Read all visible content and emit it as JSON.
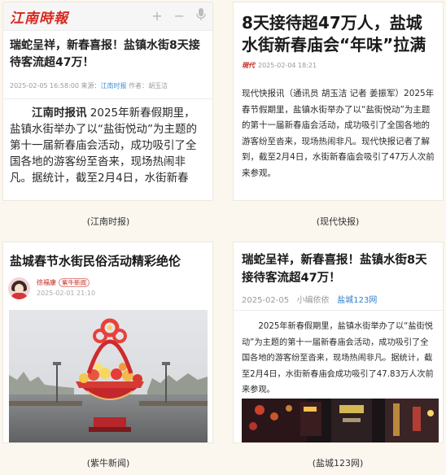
{
  "cards": [
    {
      "logo": "江南時報",
      "title": "瑞蛇呈祥，新春喜报！盐镇水街8天接待客流超47万！",
      "date": "2025-02-05 16:58:00",
      "source_label": "来源：",
      "source": "江南时报",
      "author_label": "作者：",
      "author": "胡玉洁",
      "body_lead": "江南时报讯",
      "body": " 2025年新春假期里，盐镇水街举办了以“盐街悦动”为主题的第十一届新春庙会活动，成功吸引了全国各地的游客纷至沓来，现场热闹非凡。据统计，截至2月4日，水街新春",
      "caption": "(江南时报)"
    },
    {
      "title": "8天接待超47万人，盐城水街新春庙会“年味”拉满",
      "brand": "現代",
      "date": "2025-02-04 18:21",
      "body": "现代快报讯（通讯员 胡玉洁 记者 姜振军）2025年春节假期里，盐镇水街举办了以“盐街悦动”为主题的第十一届新春庙会活动，成功吸引了全国各地的游客纷至沓来，现场热闹非凡。现代快报记者了解到，截至2月4日，水街新春庙会吸引了47万人次前来参观。",
      "caption": "(现代快报)"
    },
    {
      "title": "盐城春节水街民俗活动精彩绝伦",
      "author": "徐福康",
      "badge": "紫牛新闻",
      "date": "2025-02-01 21:10",
      "caption": "(紫牛新闻)"
    },
    {
      "title": "瑞蛇呈祥，新春喜报！盐镇水街8天接待客流超47万！",
      "date": "2025-02-05",
      "editor": "小编依依",
      "source": "盐城123网",
      "body": "2025年新春假期里，盐镇水街举办了以“盐街悦动”为主题的第十一届新春庙会活动，成功吸引了全国各地的游客纷至沓来，现场热闹非凡。据统计，截至2月4日，水街新春庙会成功吸引了47.83万人次前来参观。",
      "caption": "(盐城123网)"
    }
  ],
  "icons": {
    "plus": "+",
    "minus": "−",
    "mic": "🎙"
  },
  "colors": {
    "brand_red": "#d8281f",
    "link_blue": "#3c8fd8",
    "background": "#fbf7ef"
  }
}
